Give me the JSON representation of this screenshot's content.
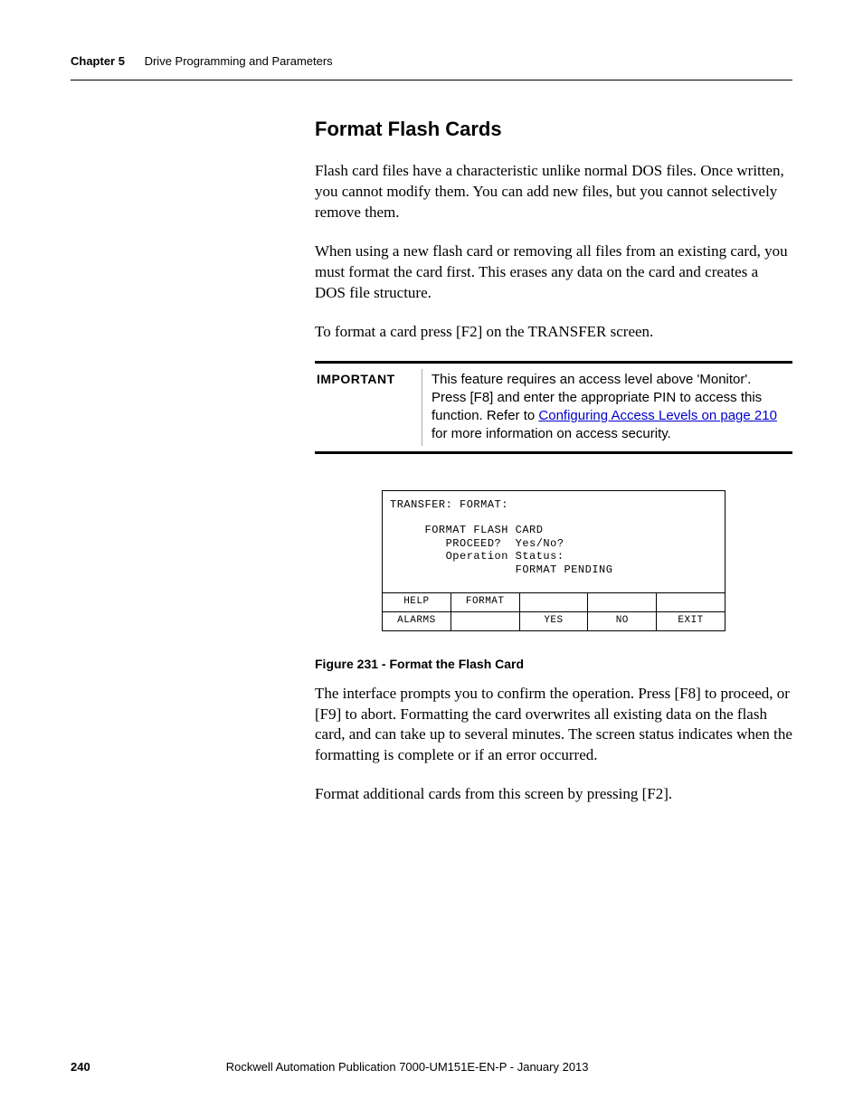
{
  "header": {
    "chapter": "Chapter 5",
    "title": "Drive Programming and Parameters"
  },
  "section_title": "Format Flash Cards",
  "para1": "Flash card files have a characteristic unlike normal DOS files. Once written, you cannot modify them. You can add new files, but you cannot selectively remove them.",
  "para2": "When using a new flash card or removing all files from an existing card, you must format the card first. This erases any data on the card and creates a DOS file structure.",
  "para3": "To format a card press [F2] on the TRANSFER screen.",
  "important": {
    "label": "IMPORTANT",
    "pre_link": "This feature requires an access level above 'Monitor'. Press [F8] and enter the appropriate PIN to access this function. Refer to ",
    "link": "Configuring Access Levels on page 210",
    "post_link": " for more information on access security."
  },
  "terminal": {
    "line1": "TRANSFER: FORMAT:",
    "line2": "     FORMAT FLASH CARD",
    "line3": "        PROCEED?  Yes/No?",
    "line4": "        Operation Status:",
    "line5": "                  FORMAT PENDING",
    "row1": {
      "c1": "HELP",
      "c2": "FORMAT",
      "c3": "",
      "c4": "",
      "c5": ""
    },
    "row2": {
      "c1": "ALARMS",
      "c2": "",
      "c3": "YES",
      "c4": "NO",
      "c5": "EXIT"
    }
  },
  "figure_caption": "Figure 231 - Format the Flash Card",
  "para4": "The interface prompts you to confirm the operation. Press [F8] to proceed, or [F9] to abort. Formatting the card overwrites all existing data on the flash card, and can take up to several minutes. The screen status indicates when the formatting is complete or if an error occurred.",
  "para5": "Format additional cards from this screen by pressing [F2].",
  "footer": {
    "page": "240",
    "publication": "Rockwell Automation Publication 7000-UM151E-EN-P - January 2013"
  }
}
